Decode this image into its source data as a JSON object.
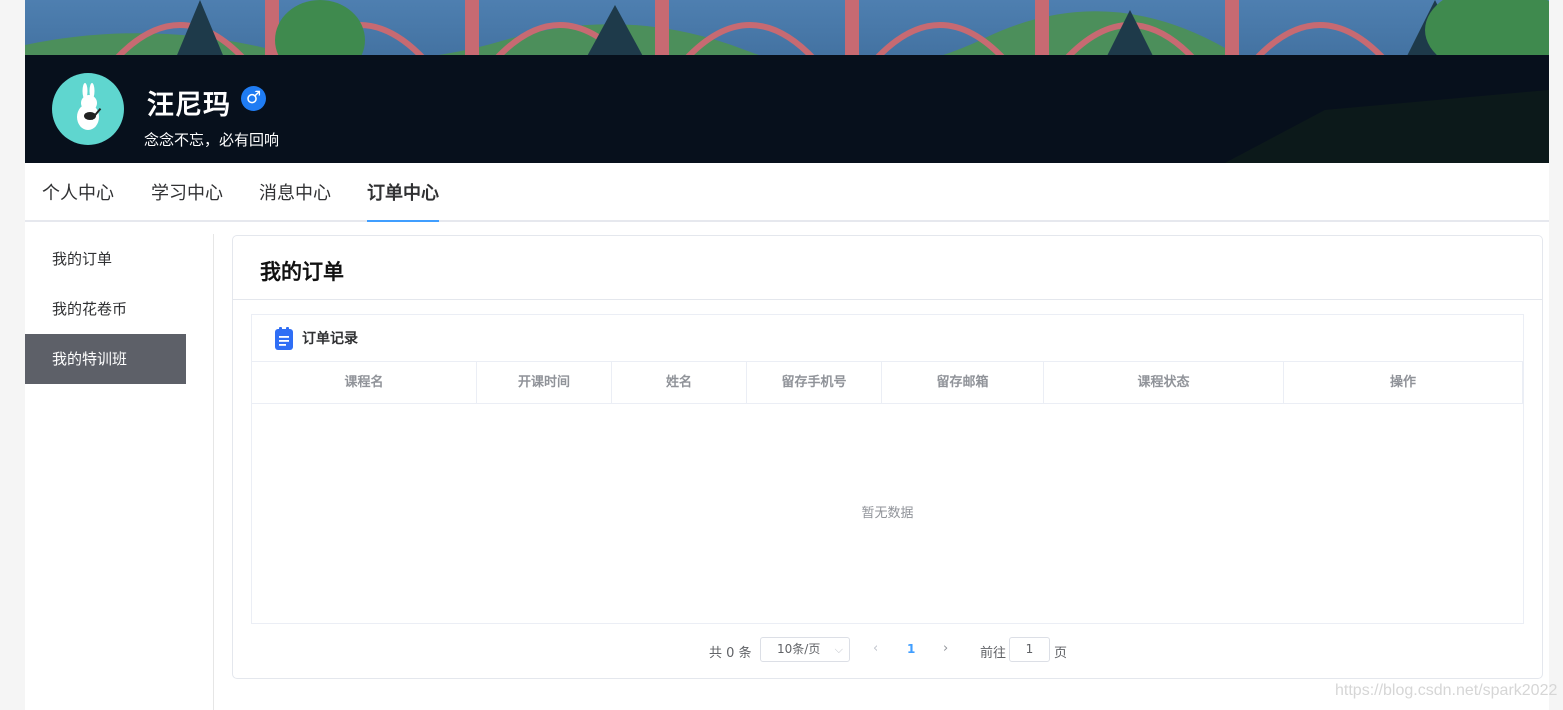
{
  "profile": {
    "name": "汪尼玛",
    "gender_symbol": "♂",
    "motto": "念念不忘，必有回响"
  },
  "tabs": [
    {
      "label": "个人中心"
    },
    {
      "label": "学习中心"
    },
    {
      "label": "消息中心"
    },
    {
      "label": "订单中心",
      "active": true
    }
  ],
  "sidebar": {
    "items": [
      {
        "label": "我的订单"
      },
      {
        "label": "我的花卷币"
      },
      {
        "label": "我的特训班",
        "active": true
      }
    ]
  },
  "main": {
    "title": "我的订单",
    "record_title": "订单记录",
    "columns": [
      "课程名",
      "开课时间",
      "姓名",
      "留存手机号",
      "留存邮箱",
      "课程状态",
      "操作"
    ],
    "empty_text": "暂无数据"
  },
  "pagination": {
    "total": "共 0 条",
    "page_size": "10条/页",
    "current_page": "1",
    "goto_label": "前往",
    "goto_value": "1",
    "unit": "页"
  },
  "watermark": "https://blog.csdn.net/spark2022",
  "colors": {
    "accent": "#409eff",
    "sidebar_active": "#5d6068",
    "gender_badge": "#1f7cf3",
    "avatar_bg": "#5fd6cf"
  }
}
